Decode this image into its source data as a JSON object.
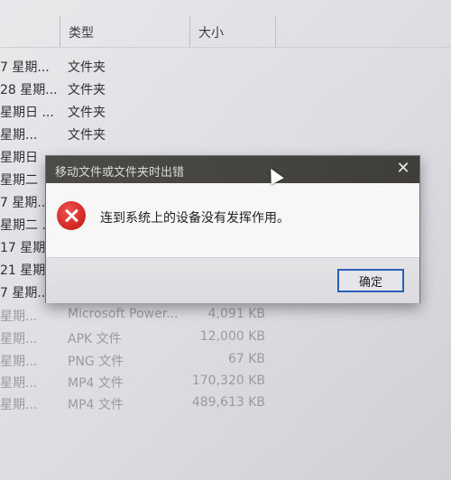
{
  "columns": {
    "type": "类型",
    "size": "大小"
  },
  "rows": [
    {
      "date": "7 星期...",
      "type": "文件夹",
      "size": ""
    },
    {
      "date": "28 星期...",
      "type": "文件夹",
      "size": ""
    },
    {
      "date": "星期日 ...",
      "type": "文件夹",
      "size": ""
    },
    {
      "date": "星期...",
      "type": "文件夹",
      "size": ""
    },
    {
      "date": "星期日",
      "type": "",
      "size": ""
    },
    {
      "date": "星期二",
      "type": "",
      "size": ""
    },
    {
      "date": "7 星期...",
      "type": "",
      "size": ""
    },
    {
      "date": "星期二 ...",
      "type": "",
      "size": ""
    },
    {
      "date": "17 星期...",
      "type": "",
      "size": ""
    },
    {
      "date": "21 星期...",
      "type": "",
      "size": ""
    },
    {
      "date": "7 星期...",
      "type": "",
      "size": ""
    },
    {
      "date": "星期...",
      "type": "Microsoft Power...",
      "size": "4,091 KB"
    },
    {
      "date": "星期...",
      "type": "APK 文件",
      "size": "12,000 KB"
    },
    {
      "date": "星期...",
      "type": "PNG 文件",
      "size": "67 KB"
    },
    {
      "date": "星期...",
      "type": "MP4 文件",
      "size": "170,320 KB"
    },
    {
      "date": "星期...",
      "type": "MP4 文件",
      "size": "489,613 KB"
    }
  ],
  "dialog": {
    "title": "移动文件或文件夹时出错",
    "close_glyph": "✕",
    "message": "连到系统上的设备没有发挥作用。",
    "ok_label": "确定"
  },
  "icons": {
    "error": "error-icon",
    "close": "close-icon",
    "cursor": "mouse-cursor-icon"
  },
  "colors": {
    "titlebar": "#3f3e3b",
    "error": "#d62a26",
    "button_border": "#2b5fb8"
  }
}
